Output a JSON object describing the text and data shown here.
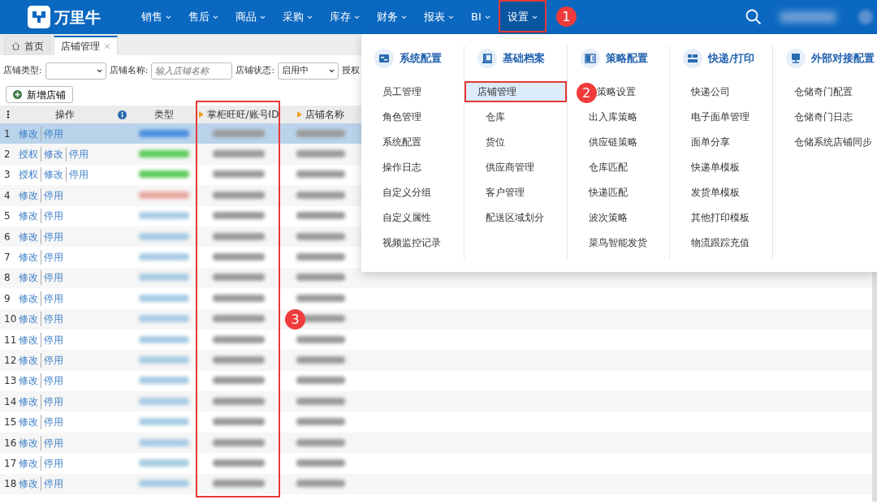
{
  "app": {
    "logo": "万里牛",
    "nav": [
      {
        "label": "销售",
        "selected": false
      },
      {
        "label": "售后",
        "selected": false
      },
      {
        "label": "商品",
        "selected": false
      },
      {
        "label": "采购",
        "selected": false
      },
      {
        "label": "库存",
        "selected": false
      },
      {
        "label": "财务",
        "selected": false
      },
      {
        "label": "报表",
        "selected": false
      },
      {
        "label": "BI",
        "selected": false
      },
      {
        "label": "设置",
        "selected": true,
        "annotation": "1"
      }
    ]
  },
  "tabs": [
    {
      "label": "首页",
      "kind": "home",
      "selected": false
    },
    {
      "label": "店铺管理",
      "kind": "closable",
      "selected": true
    }
  ],
  "filters": [
    {
      "label": "店铺类型:",
      "kind": "select"
    },
    {
      "label": "店铺名称:",
      "kind": "text",
      "placeholder": "输入店铺名称"
    },
    {
      "label": "店铺状态:",
      "kind": "select",
      "value": "启用中"
    },
    {
      "label": "授权",
      "kind": "label"
    }
  ],
  "add_button": "新增店铺",
  "table": {
    "columns": [
      {
        "label": "操作",
        "kind": "plain"
      },
      {
        "label": "类型",
        "kind": "plain"
      },
      {
        "label": "掌柜旺旺/账号ID",
        "kind": "sortable",
        "annotation": "3"
      },
      {
        "label": "店铺名称",
        "kind": "sortable"
      }
    ],
    "rows": [
      {
        "index": "1",
        "actions": [
          "修改",
          "停用"
        ],
        "selected": true,
        "color": "#4a8fe0"
      },
      {
        "index": "2",
        "actions": [
          "授权",
          "修改",
          "停用"
        ],
        "selected": false,
        "color": "#5ccc5c"
      },
      {
        "index": "3",
        "actions": [
          "授权",
          "修改",
          "停用"
        ],
        "selected": false,
        "color": "#5ccc5c"
      },
      {
        "index": "4",
        "actions": [
          "修改",
          "停用"
        ],
        "selected": false,
        "color": "#e8a8a0"
      },
      {
        "index": "5",
        "actions": [
          "修改",
          "停用"
        ],
        "selected": false,
        "color": "#a8cbe4"
      },
      {
        "index": "6",
        "actions": [
          "修改",
          "停用"
        ],
        "selected": false,
        "color": "#a8cbe4"
      },
      {
        "index": "7",
        "actions": [
          "修改",
          "停用"
        ],
        "selected": false,
        "color": "#a8cbe4"
      },
      {
        "index": "8",
        "actions": [
          "修改",
          "停用"
        ],
        "selected": false,
        "color": "#a8cbe4"
      },
      {
        "index": "9",
        "actions": [
          "修改",
          "停用"
        ],
        "selected": false,
        "color": "#a8cbe4"
      },
      {
        "index": "10",
        "actions": [
          "修改",
          "停用"
        ],
        "selected": false,
        "color": "#a8cbe4"
      },
      {
        "index": "11",
        "actions": [
          "修改",
          "停用"
        ],
        "selected": false,
        "color": "#a8cbe4"
      },
      {
        "index": "12",
        "actions": [
          "修改",
          "停用"
        ],
        "selected": false,
        "color": "#a8cbe4"
      },
      {
        "index": "13",
        "actions": [
          "修改",
          "停用"
        ],
        "selected": false,
        "color": "#a8cbe4"
      },
      {
        "index": "14",
        "actions": [
          "修改",
          "停用"
        ],
        "selected": false,
        "color": "#a8cbe4"
      },
      {
        "index": "15",
        "actions": [
          "修改",
          "停用"
        ],
        "selected": false,
        "color": "#a8cbe4"
      },
      {
        "index": "16",
        "actions": [
          "修改",
          "停用"
        ],
        "selected": false,
        "color": "#a8cbe4"
      },
      {
        "index": "17",
        "actions": [
          "修改",
          "停用"
        ],
        "selected": false,
        "color": "#a8cbe4"
      },
      {
        "index": "18",
        "actions": [
          "修改",
          "停用"
        ],
        "selected": false,
        "color": "#a8cbe4"
      }
    ]
  },
  "menu": {
    "sections": [
      {
        "title": "系统配置",
        "kind": "config",
        "items": [
          {
            "label": "员工管理",
            "selected": false
          },
          {
            "label": "角色管理",
            "selected": false
          },
          {
            "label": "系统配置",
            "selected": false
          },
          {
            "label": "操作日志",
            "selected": false
          },
          {
            "label": "自定义分组",
            "selected": false
          },
          {
            "label": "自定义属性",
            "selected": false
          },
          {
            "label": "视频监控记录",
            "selected": false
          }
        ]
      },
      {
        "title": "基础档案",
        "kind": "archive",
        "items": [
          {
            "label": "店铺管理",
            "selected": true,
            "annotation": "2"
          },
          {
            "label": "仓库",
            "selected": false
          },
          {
            "label": "货位",
            "selected": false
          },
          {
            "label": "供应商管理",
            "selected": false
          },
          {
            "label": "客户管理",
            "selected": false
          },
          {
            "label": "配送区域划分",
            "selected": false
          }
        ]
      },
      {
        "title": "策略配置",
        "kind": "strategy",
        "items": [
          {
            "label": "策略设置",
            "selected": false,
            "covered": true
          },
          {
            "label": "出入库策略",
            "selected": false
          },
          {
            "label": "供应链策略",
            "selected": false
          },
          {
            "label": "仓库匹配",
            "selected": false
          },
          {
            "label": "快递匹配",
            "selected": false
          },
          {
            "label": "波次策略",
            "selected": false
          },
          {
            "label": "菜鸟智能发货",
            "selected": false
          }
        ]
      },
      {
        "title": "快递/打印",
        "kind": "print",
        "items": [
          {
            "label": "快递公司",
            "selected": false
          },
          {
            "label": "电子面单管理",
            "selected": false
          },
          {
            "label": "面单分享",
            "selected": false
          },
          {
            "label": "快递单模板",
            "selected": false
          },
          {
            "label": "发货单模板",
            "selected": false
          },
          {
            "label": "其他打印模板",
            "selected": false
          },
          {
            "label": "物流跟踪充值",
            "selected": false
          }
        ]
      },
      {
        "title": "外部对接配置",
        "kind": "external",
        "items": [
          {
            "label": "仓储奇门配置",
            "selected": false
          },
          {
            "label": "仓储奇门日志",
            "selected": false
          },
          {
            "label": "仓储系统店铺同步",
            "selected": false
          }
        ]
      }
    ]
  }
}
